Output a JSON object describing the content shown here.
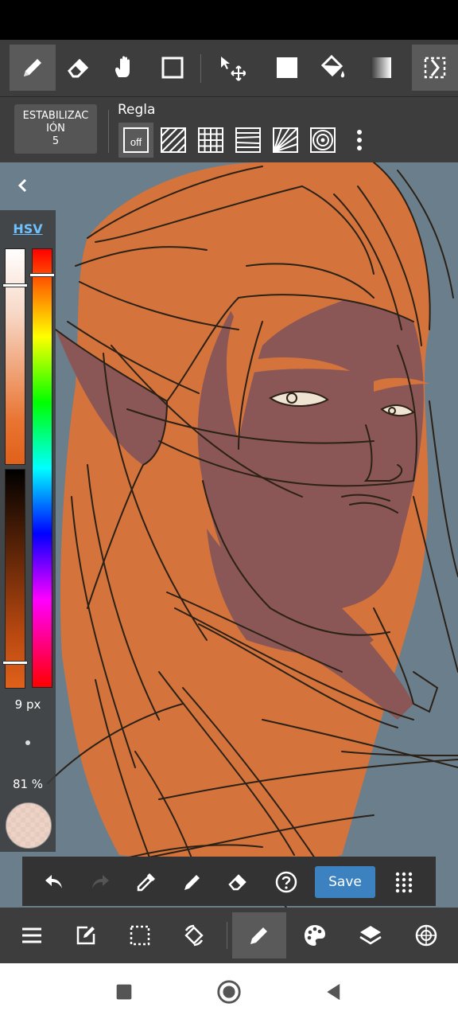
{
  "toolbar": {
    "tools": [
      "brush-tool",
      "eraser-tool",
      "hand-tool",
      "rectangle-tool",
      "move-tool",
      "fill-color-tool",
      "bucket-tool",
      "gradient-tool",
      "selection-tool"
    ]
  },
  "stabilizer": {
    "line1": "ESTABILIZAC",
    "line2": "IÓN",
    "value": "5"
  },
  "ruler": {
    "label": "Regla",
    "off_label": "off"
  },
  "color_panel": {
    "mode_label": "HSV",
    "brush_size": "9 px",
    "opacity": "81 %",
    "current_color": "#f0d6c8"
  },
  "bottom_tools": {
    "save_label": "Save"
  },
  "colors": {
    "accent": "#3c82c0",
    "toolbar_bg": "#3d3d3d",
    "canvas_bg": "#6b7e8c",
    "hair": "#d4743c",
    "skin": "#8a5756",
    "line": "#2b2116"
  }
}
